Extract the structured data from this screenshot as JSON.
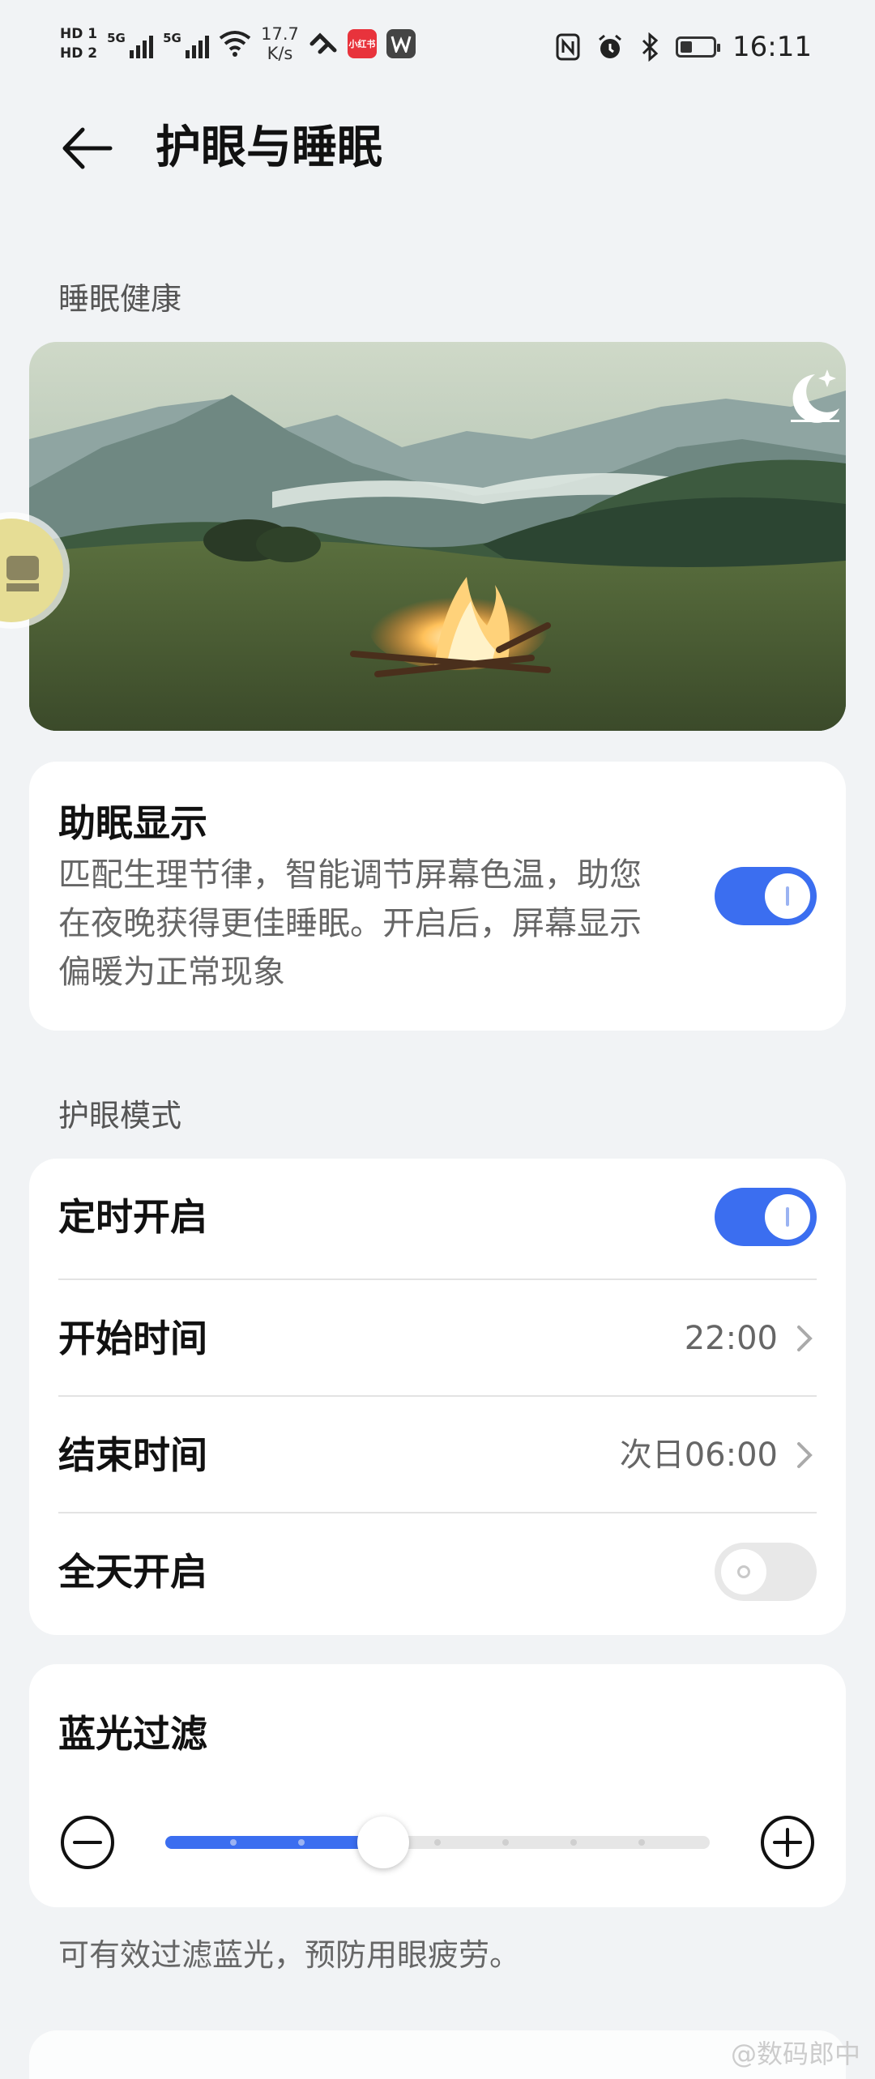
{
  "status_bar": {
    "hd1": "HD 1",
    "hd2": "HD 2",
    "sig1": "5G",
    "sig2": "5G",
    "speed_value": "17.7",
    "speed_unit": "K/s",
    "app_icon_red": "小红书",
    "time": "16:11"
  },
  "header": {
    "title": "护眼与睡眠"
  },
  "sleep_section": {
    "label": "睡眠健康"
  },
  "sleep_display": {
    "title": "助眠显示",
    "desc_line1": "匹配生理节律，智能调节屏幕色温，助您",
    "desc_line2": "在夜晚获得更佳睡眠。开启后，屏幕显示",
    "desc_line3": "偏暖为正常现象",
    "enabled": true
  },
  "eye_section": {
    "label": "护眼模式",
    "rows": [
      {
        "label": "定时开启",
        "type": "toggle",
        "enabled": true
      },
      {
        "label": "开始时间",
        "value": "22:00"
      },
      {
        "label": "结束时间",
        "value": "次日06:00"
      },
      {
        "label": "全天开启",
        "type": "toggle",
        "enabled": false
      }
    ]
  },
  "blue_light": {
    "title": "蓝光过滤",
    "level": 0.4,
    "steps": 9
  },
  "footnote": "可有效过滤蓝光，预防用眼疲劳。",
  "watermark": "@数码郎中",
  "colors": {
    "accent": "#3b6ef0",
    "background": "#f1f3f5"
  }
}
